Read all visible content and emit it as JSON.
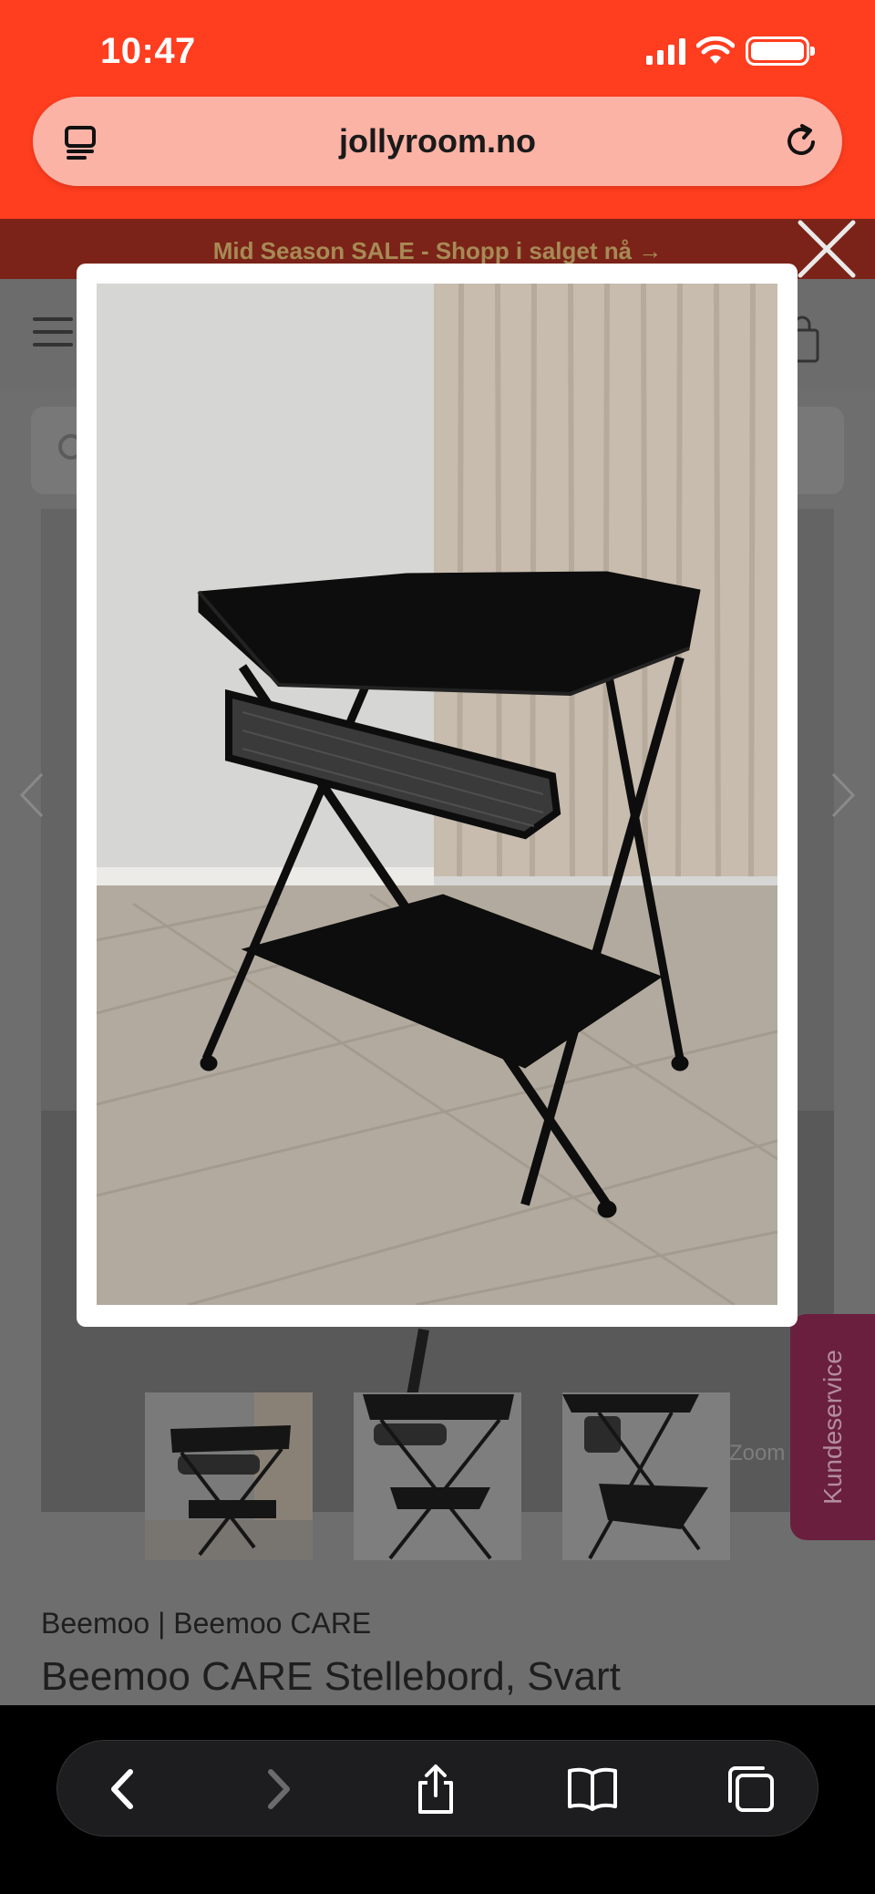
{
  "status_bar": {
    "time": "10:47"
  },
  "browser": {
    "url": "jollyroom.no"
  },
  "page": {
    "sale_banner": "Mid Season SALE - Shopp i salget nå →",
    "zoom_label": "Zoom",
    "brand_line": "Beemoo | Beemoo CARE",
    "product_title": "Beemoo CARE Stellebord, Svart",
    "kundeservice": "Kundeservice",
    "thumbnails": [
      "Stellebord angle view",
      "Stellebord front view",
      "Stellebord side view"
    ]
  },
  "colors": {
    "accent": "#ff3d1f",
    "kundeservice": "#6a1f3e",
    "product": "#0d0d0d"
  },
  "icons": [
    "tabs-reader-icon",
    "reload-icon",
    "menu-icon",
    "cart-icon",
    "close-icon",
    "chevron-left-icon",
    "chevron-right-icon",
    "back-icon",
    "forward-icon",
    "share-icon",
    "bookmarks-icon",
    "tabs-icon"
  ]
}
